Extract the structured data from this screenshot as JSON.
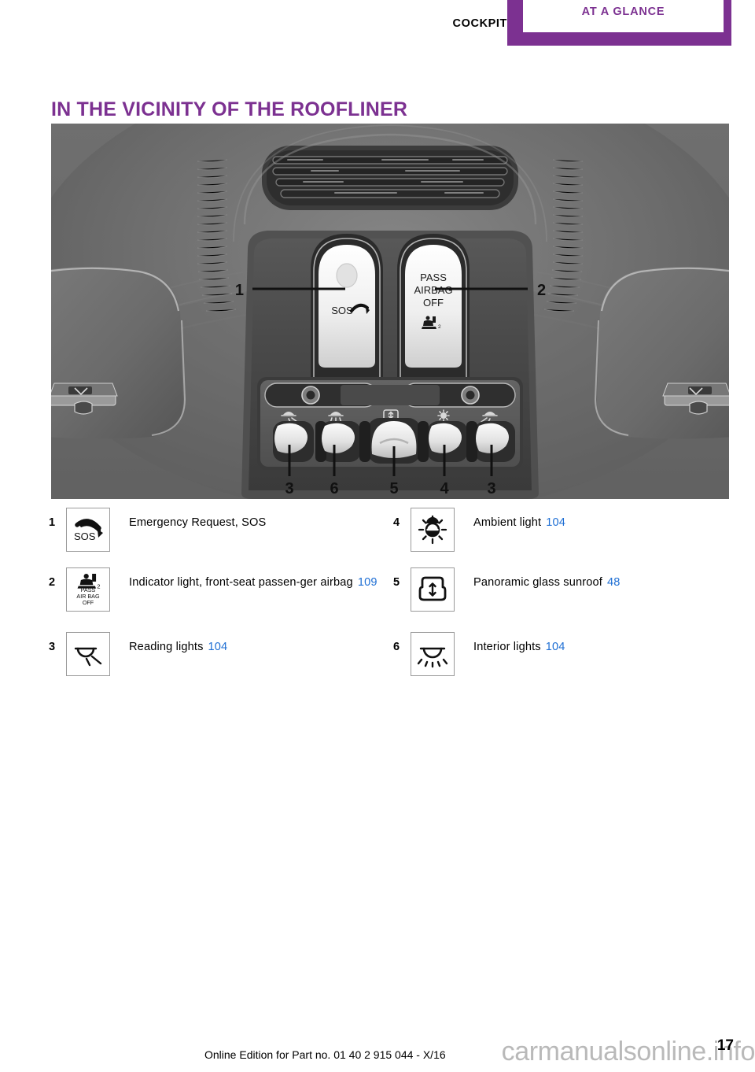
{
  "header": {
    "chapter": "COCKPIT",
    "section_tab": "AT A GLANCE",
    "accent_color": "#7c3191"
  },
  "page": {
    "title": "IN THE VICINITY OF THE ROOFLINER",
    "title_color": "#7c3191",
    "pageref_color": "#1f6fd4"
  },
  "photo": {
    "alt": "Overhead console / roofliner of vehicle showing SOS button, passenger airbag indicator, light switches and sunroof control",
    "callouts": [
      {
        "number": "1",
        "side": "left",
        "target": "sos-button"
      },
      {
        "number": "2",
        "side": "right",
        "target": "pass-airbag-off-indicator"
      },
      {
        "number": "3",
        "side": "bottom",
        "target": "reading-light-left"
      },
      {
        "number": "6",
        "side": "bottom",
        "target": "interior-light"
      },
      {
        "number": "5",
        "side": "bottom",
        "target": "sunroof-rocker"
      },
      {
        "number": "4",
        "side": "bottom",
        "target": "ambient-light"
      },
      {
        "number": "3",
        "side": "bottom",
        "target": "reading-light-right"
      }
    ],
    "button_labels": {
      "sos": "SOS",
      "pass_airbag_off": [
        "PASS",
        "AIRBAG",
        "OFF"
      ]
    }
  },
  "legend": {
    "left": [
      {
        "number": "1",
        "icon": "sos-phone-icon",
        "icon_text": "SOS",
        "label": "Emergency Request, SOS",
        "pageref": ""
      },
      {
        "number": "2",
        "icon": "pass-airbag-off-icon",
        "icon_text": "PASS AIR BAG OFF",
        "label": "Indicator light, front-seat passen‑ger airbag",
        "pageref": "109"
      },
      {
        "number": "3",
        "icon": "reading-light-icon",
        "icon_text": "",
        "label": "Reading lights",
        "pageref": "104"
      }
    ],
    "right": [
      {
        "number": "4",
        "icon": "ambient-light-sun-icon",
        "icon_text": "",
        "label": "Ambient light",
        "pageref": "104"
      },
      {
        "number": "5",
        "icon": "panoramic-sunroof-icon",
        "icon_text": "",
        "label": "Panoramic glass sunroof",
        "pageref": "48"
      },
      {
        "number": "6",
        "icon": "interior-light-icon",
        "icon_text": "",
        "label": "Interior lights",
        "pageref": "104"
      }
    ]
  },
  "footer": {
    "edition_note": "Online Edition for Part no. 01 40 2 915 044 - X/16",
    "page_number": "17",
    "watermark": "carmanualsonline.info"
  }
}
